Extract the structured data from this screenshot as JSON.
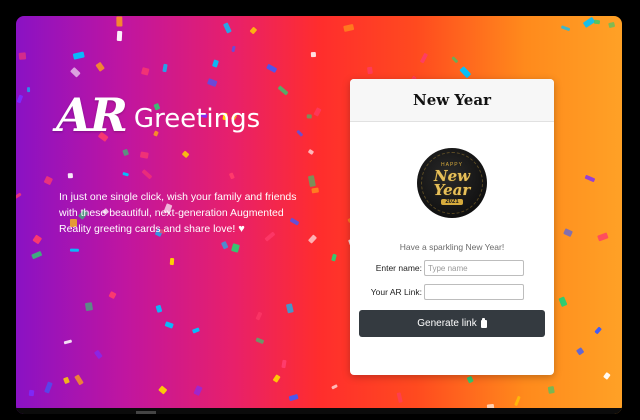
{
  "brand": {
    "ar": "AR",
    "word": "Greetings"
  },
  "tagline": {
    "text": "In just one single click, wish your family and friends with these beautiful, next-generation Augmented Reality greeting cards and share love!",
    "heart": "♥"
  },
  "card": {
    "title": "New Year",
    "badge": {
      "top": "HAPPY",
      "line1": "New",
      "line2": "Year",
      "year": "2021"
    },
    "subtitle": "Have a sparkling New Year!",
    "name_label": "Enter name:",
    "name_placeholder": "Type name",
    "name_value": "",
    "link_label": "Your AR Link:",
    "link_value": "",
    "button_label": "Generate link"
  },
  "colors": {
    "gradient": [
      "#8a12c4",
      "#c015a0",
      "#e8206a",
      "#ff2d2d",
      "#ff4a1f",
      "#ff8a1c",
      "#ffa126"
    ],
    "button": "#343a40",
    "badge_gold": "#d6aa3c"
  },
  "icons": {
    "button_icon": "clipboard-icon",
    "heart_icon": "heart-icon"
  }
}
